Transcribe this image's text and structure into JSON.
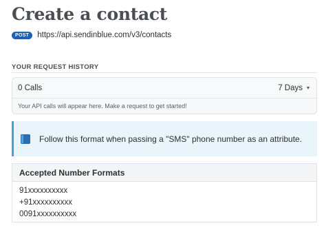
{
  "page": {
    "title": "Create a contact",
    "method": "POST",
    "url": "https://api.sendinblue.com/v3/contacts"
  },
  "history": {
    "label": "YOUR REQUEST HISTORY",
    "calls": "0 Calls",
    "period": "7 Days",
    "hint": "Your API calls will appear here. Make a request to get started!"
  },
  "callout": {
    "icon": "book-icon",
    "text": "Follow this format when passing a \"SMS\" phone number as an attribute."
  },
  "formats": {
    "header": "Accepted Number Formats",
    "items": [
      "91xxxxxxxxxx",
      "+91xxxxxxxxxx",
      "0091xxxxxxxxxx"
    ]
  },
  "colors": {
    "method_badge": "#1f5fb5",
    "callout_bg": "#eaf4fb",
    "callout_border": "#4a9fd5"
  }
}
